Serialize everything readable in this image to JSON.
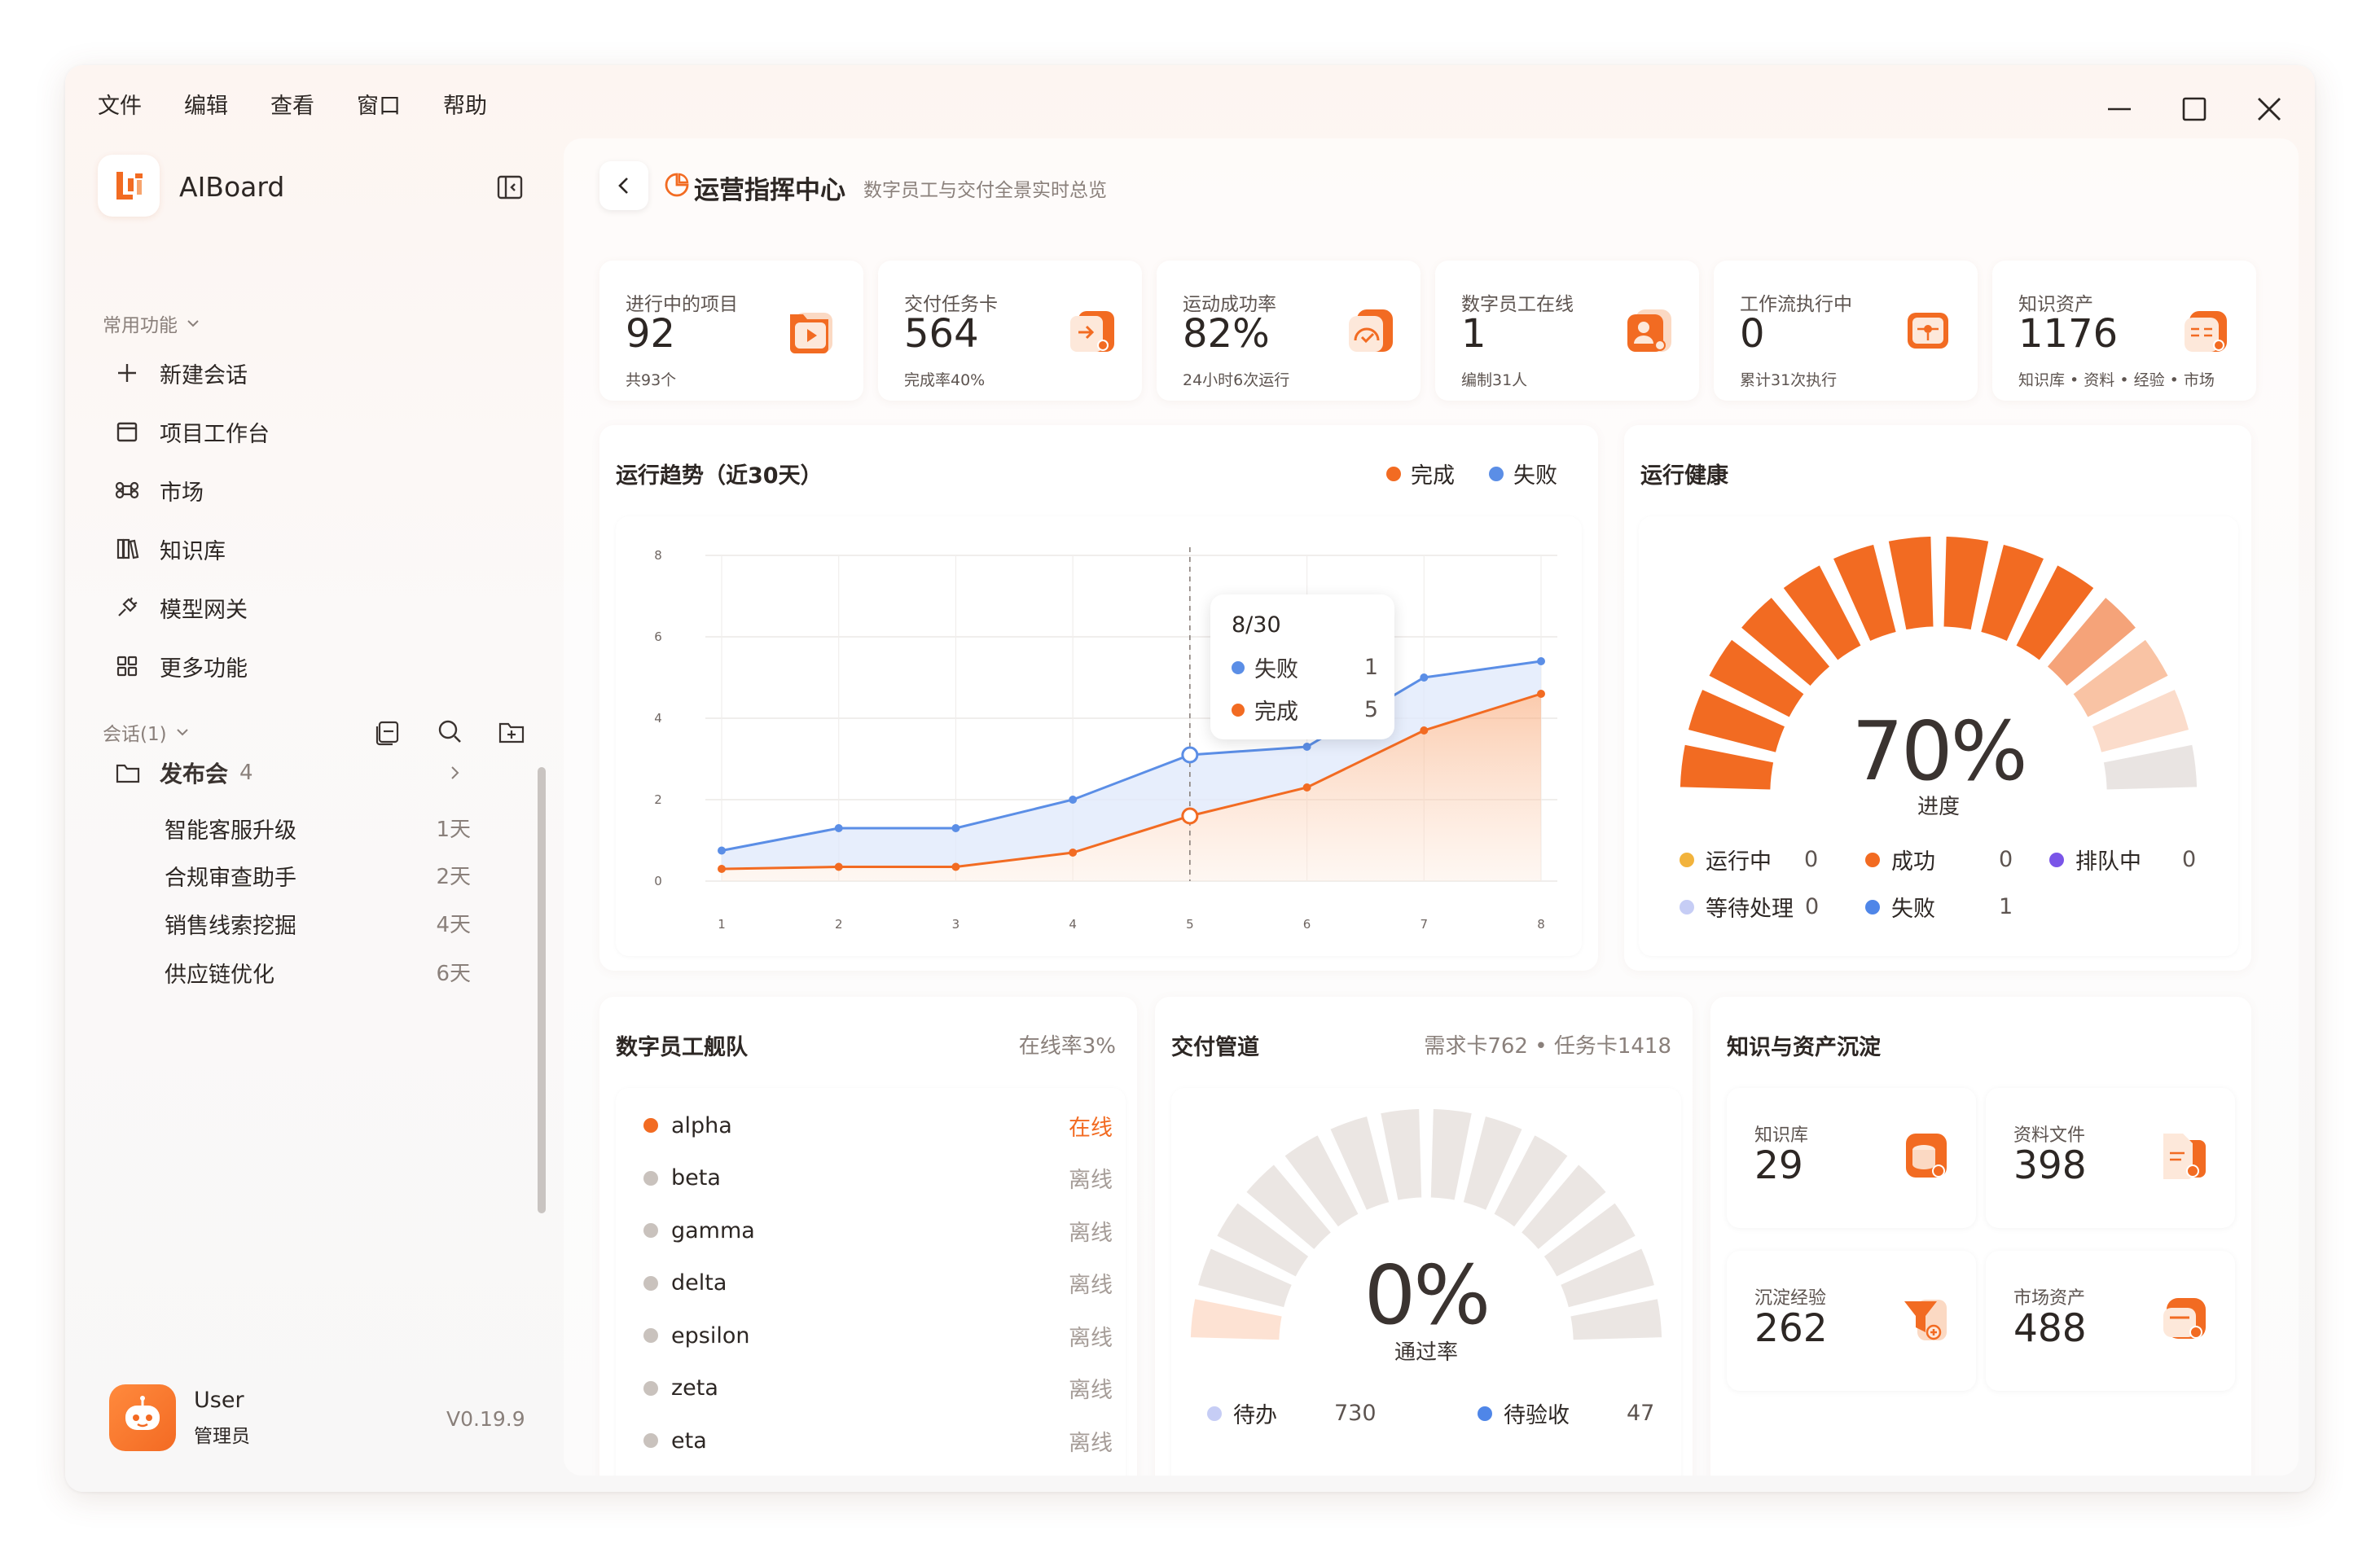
{
  "menu": [
    "文件",
    "编辑",
    "查看",
    "窗口",
    "帮助"
  ],
  "app": {
    "name": "AIBoard",
    "logo_text": "Li"
  },
  "sidebar": {
    "common_label": "常用功能",
    "nav": [
      {
        "label": "新建会话",
        "icon": "plus-icon"
      },
      {
        "label": "项目工作台",
        "icon": "calendar-icon"
      },
      {
        "label": "市场",
        "icon": "command-icon"
      },
      {
        "label": "知识库",
        "icon": "books-icon"
      },
      {
        "label": "模型网关",
        "icon": "plug-icon"
      },
      {
        "label": "更多功能",
        "icon": "grid-icon"
      }
    ],
    "sessions_label": "会话(1)",
    "folder": {
      "name": "发布会",
      "count": "4"
    },
    "sessions": [
      {
        "name": "智能客服升级",
        "age": "1天"
      },
      {
        "name": "合规审查助手",
        "age": "2天"
      },
      {
        "name": "销售线索挖掘",
        "age": "4天"
      },
      {
        "name": "供应链优化",
        "age": "6天"
      }
    ],
    "user": {
      "name": "User",
      "role": "管理员"
    },
    "version": "V0.19.9"
  },
  "header": {
    "title": "运营指挥中心",
    "subtitle": "数字员工与交付全景实时总览"
  },
  "stats": [
    {
      "label": "进行中的项目",
      "value": "92",
      "sub": "共93个"
    },
    {
      "label": "交付任务卡",
      "value": "564",
      "sub": "完成率40%"
    },
    {
      "label": "运动成功率",
      "value": "82%",
      "sub": "24小时6次运行"
    },
    {
      "label": "数字员工在线",
      "value": "1",
      "sub": "编制31人"
    },
    {
      "label": "工作流执行中",
      "value": "0",
      "sub": "累计31次执行"
    },
    {
      "label": "知识资产",
      "value": "1176",
      "sub": "知识库 • 资料 • 经验 • 市场"
    }
  ],
  "trend": {
    "title": "运行趋势（近30天）",
    "legend_done": "完成",
    "legend_fail": "失败",
    "tooltip": {
      "date": "8/30",
      "fail_label": "失败",
      "fail_value": "1",
      "done_label": "完成",
      "done_value": "5"
    }
  },
  "chart_data": {
    "type": "area",
    "x": [
      1,
      2,
      3,
      4,
      5,
      6,
      7,
      8
    ],
    "ylim": [
      0,
      8
    ],
    "yticks": [
      0,
      2,
      4,
      6,
      8
    ],
    "series": [
      {
        "name": "完成",
        "color": "#f26b22",
        "values": [
          0.3,
          0.35,
          0.35,
          0.7,
          1.6,
          2.3,
          3.7,
          4.6
        ]
      },
      {
        "name": "失败",
        "color": "#5b8ee6",
        "values": [
          0.75,
          1.3,
          1.3,
          2.0,
          3.1,
          3.3,
          5.0,
          5.4
        ]
      }
    ]
  },
  "health": {
    "title": "运行健康",
    "percent": "70%",
    "caption": "进度",
    "fill_fraction": 0.7,
    "legend": [
      {
        "label": "运行中",
        "value": "0",
        "color": "#f2b33c"
      },
      {
        "label": "成功",
        "value": "0",
        "color": "#f26b22"
      },
      {
        "label": "排队中",
        "value": "0",
        "color": "#7a55e8"
      },
      {
        "label": "等待处理",
        "value": "0",
        "color": "#c6cdf5"
      },
      {
        "label": "失败",
        "value": "1",
        "color": "#4f86e8"
      }
    ]
  },
  "fleet": {
    "title": "数字员工舰队",
    "note": "在线率3%",
    "members": [
      {
        "name": "alpha",
        "status": "在线",
        "online": true
      },
      {
        "name": "beta",
        "status": "离线",
        "online": false
      },
      {
        "name": "gamma",
        "status": "离线",
        "online": false
      },
      {
        "name": "delta",
        "status": "离线",
        "online": false
      },
      {
        "name": "epsilon",
        "status": "离线",
        "online": false
      },
      {
        "name": "zeta",
        "status": "离线",
        "online": false
      },
      {
        "name": "eta",
        "status": "离线",
        "online": false
      }
    ]
  },
  "pipeline": {
    "title": "交付管道",
    "note": "需求卡762 • 任务卡1418",
    "percent": "0%",
    "caption": "通过率",
    "fill_fraction": 0.0,
    "legend": [
      {
        "label": "待办",
        "value": "730",
        "color": "#c6cdf5"
      },
      {
        "label": "待验收",
        "value": "47",
        "color": "#4f86e8"
      }
    ]
  },
  "knowledge": {
    "title": "知识与资产沉淀",
    "cards": [
      {
        "label": "知识库",
        "value": "29"
      },
      {
        "label": "资料文件",
        "value": "398"
      },
      {
        "label": "沉淀经验",
        "value": "262"
      },
      {
        "label": "市场资产",
        "value": "488"
      }
    ]
  },
  "colors": {
    "accent": "#f26b22",
    "blue": "#5b8ee6",
    "muted": "#8a807b"
  }
}
